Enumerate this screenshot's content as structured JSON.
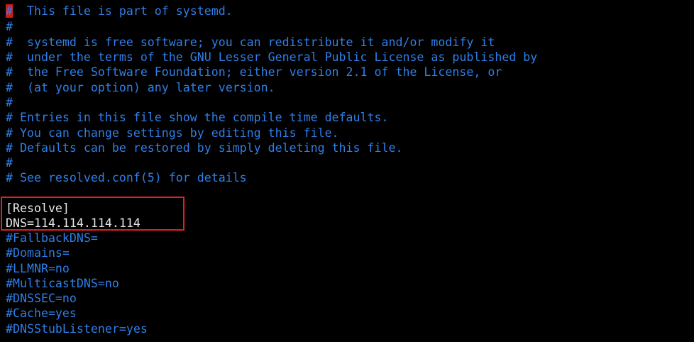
{
  "file": {
    "cursor_char": "#",
    "first_line_rest": "  This file is part of systemd.",
    "lines": [
      "#",
      "#  systemd is free software; you can redistribute it and/or modify it",
      "#  under the terms of the GNU Lesser General Public License as published by",
      "#  the Free Software Foundation; either version 2.1 of the License, or",
      "#  (at your option) any later version.",
      "#",
      "# Entries in this file show the compile time defaults.",
      "# You can change settings by editing this file.",
      "# Defaults can be restored by simply deleting this file.",
      "#",
      "# See resolved.conf(5) for details",
      "",
      "[Resolve]",
      "DNS=114.114.114.114",
      "#FallbackDNS=",
      "#Domains=",
      "#LLMNR=no",
      "#MulticastDNS=no",
      "#DNSSEC=no",
      "#Cache=yes",
      "#DNSStubListener=yes"
    ]
  },
  "colors": {
    "background": "#000000",
    "comment": "#2f7fe8",
    "text": "#e8e8e8",
    "cursor": "#d01a1a",
    "highlight_box": "#e0202a"
  }
}
